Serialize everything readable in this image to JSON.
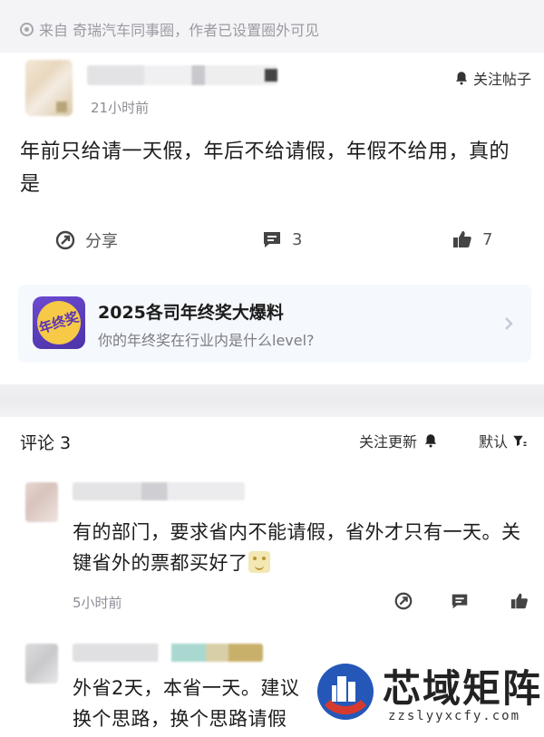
{
  "source": {
    "text": "来自 奇瑞汽车同事圈，作者已设置圈外可见"
  },
  "post": {
    "time": "21小时前",
    "follow_label": "关注帖子",
    "text": "年前只给请一天假，年后不给请假，年假不给用，真的是",
    "actions": {
      "share": "分享",
      "comments": "3",
      "likes": "7"
    }
  },
  "promo": {
    "logo_text": "年终奖",
    "title": "2025各司年终奖大爆料",
    "subtitle": "你的年终奖在行业内是什么level?"
  },
  "comments_header": {
    "title": "评论 3",
    "follow_updates": "关注更新",
    "sort": "默认"
  },
  "comments": [
    {
      "text": "有的部门，要求省内不能请假，省外才只有一天。关键省外的票都买好了",
      "time": "5小时前"
    },
    {
      "text": "外省2天，本省一天。建议换个思路，换个思路请假"
    }
  ],
  "watermark": {
    "title": "芯域矩阵",
    "url": "zzslyyxcfy.com"
  }
}
